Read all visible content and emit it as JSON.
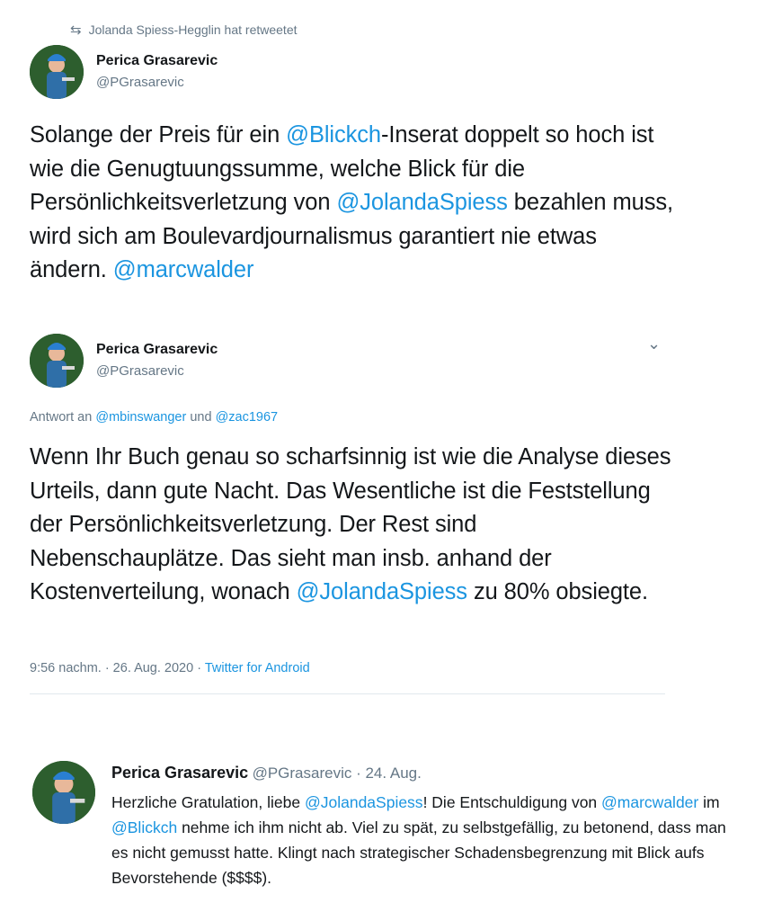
{
  "retweet": {
    "icon": "retweet-icon",
    "label": "Jolanda Spiess-Hegglin hat retweetet"
  },
  "tweet1": {
    "name": "Perica Grasarevic",
    "handle": "@PGrasarevic",
    "text_parts": [
      "Solange der Preis für ein ",
      "@Blickch",
      "-Inserat doppelt so hoch ist wie die Genugtuungssumme, welche Blick für die Persönlichkeitsverletzung von ",
      "@JolandaSpiess",
      " bezahlen muss, wird sich am Boulevardjournalismus garantiert nie etwas ändern. ",
      "@marcwalder"
    ]
  },
  "tweet2": {
    "name": "Perica Grasarevic",
    "handle": "@PGrasarevic",
    "reply_prefix": "Antwort an ",
    "reply_to_1": "@mbinswanger",
    "reply_and": " und ",
    "reply_to_2": "@zac1967",
    "text_parts": [
      "Wenn Ihr Buch genau so scharfsinnig ist wie die Analyse dieses Urteils, dann gute Nacht. Das Wesentliche ist die Feststellung der Persönlichkeitsverletzung. Der Rest sind Nebenschauplätze. Das sieht man insb. anhand der Kostenverteilung, wonach ",
      "@JolandaSpiess",
      " zu 80% obsiegte."
    ],
    "timestamp": "9:56 nachm. · 26. Aug. 2020 · ",
    "source": "Twitter for Android",
    "menu_icon": "chevron-down-icon"
  },
  "tweet3": {
    "name": "Perica Grasarevic",
    "handle_date": "@PGrasarevic · 24. Aug.",
    "text_parts": [
      "Herzliche Gratulation, liebe ",
      "@JolandaSpiess",
      "! Die Entschuldigung von ",
      "@marcwalder",
      " im ",
      "@Blickch",
      " nehme ich ihm nicht ab. Viel zu spät, zu selbstgefällig, zu betonend, dass man es nicht gemusst hatte. Klingt nach strategischer Schadensbegrenzung mit Blick aufs Bevorstehende ($$$$)."
    ]
  },
  "colors": {
    "link": "#1b95e0",
    "secondary": "#657786",
    "text": "#14171a",
    "divider": "#e1e8ed"
  }
}
